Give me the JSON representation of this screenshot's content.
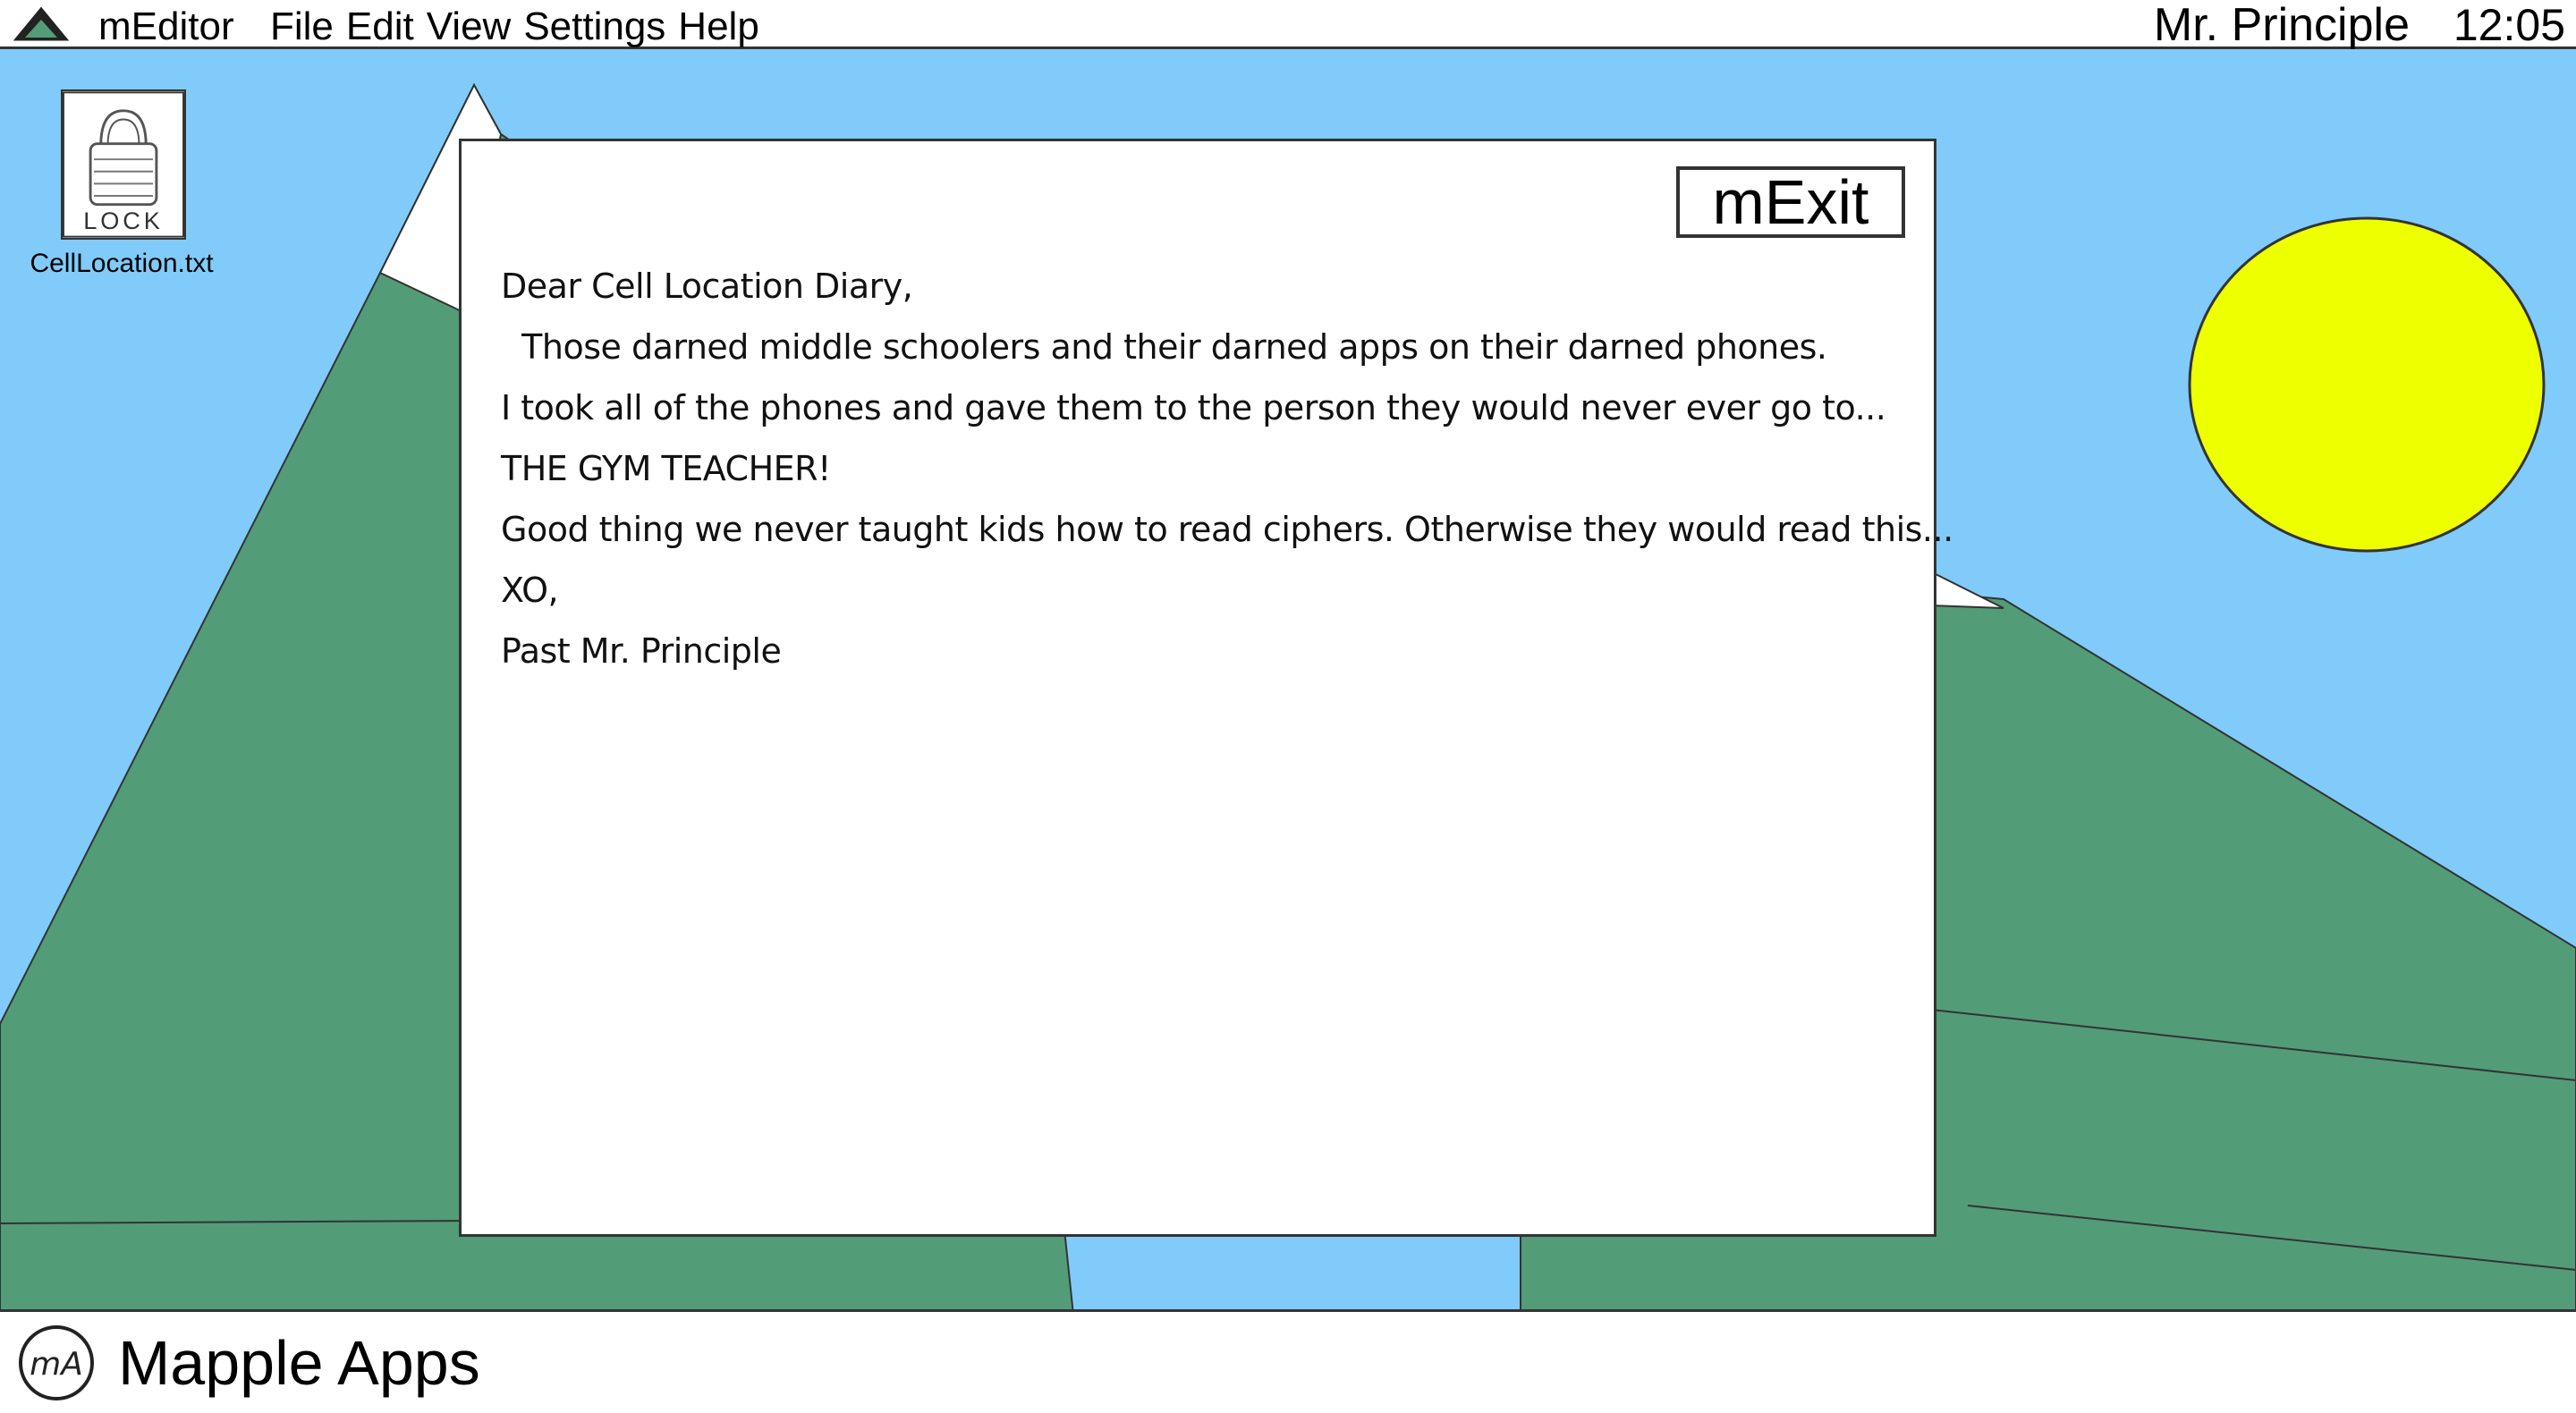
{
  "menubar": {
    "app_name": "mEditor",
    "menus": [
      "File",
      "Edit",
      "View",
      "Settings",
      "Help"
    ],
    "user": "Mr. Principle",
    "time": "12:05"
  },
  "desktop": {
    "file_icon": {
      "label": "CellLocation.txt",
      "thumb_text": "LOCK",
      "icon": "lock-icon"
    },
    "colors": {
      "sky": "#80cbfa",
      "mountain": "#539c78",
      "snow": "#ffffff",
      "sun": "#eeff00"
    }
  },
  "editor": {
    "exit_label": "mExit",
    "lines": [
      "Dear Cell Location Diary,",
      "  Those darned middle schoolers and their darned apps on their darned phones.",
      "I took all of the phones and gave them to the person they would never ever go to...",
      "THE GYM TEACHER!",
      "Good thing we never taught kids how to read ciphers. Otherwise they would read this...",
      "XO,",
      "Past Mr. Principle"
    ]
  },
  "dock": {
    "logo_text": "mA",
    "label": "Mapple Apps"
  }
}
